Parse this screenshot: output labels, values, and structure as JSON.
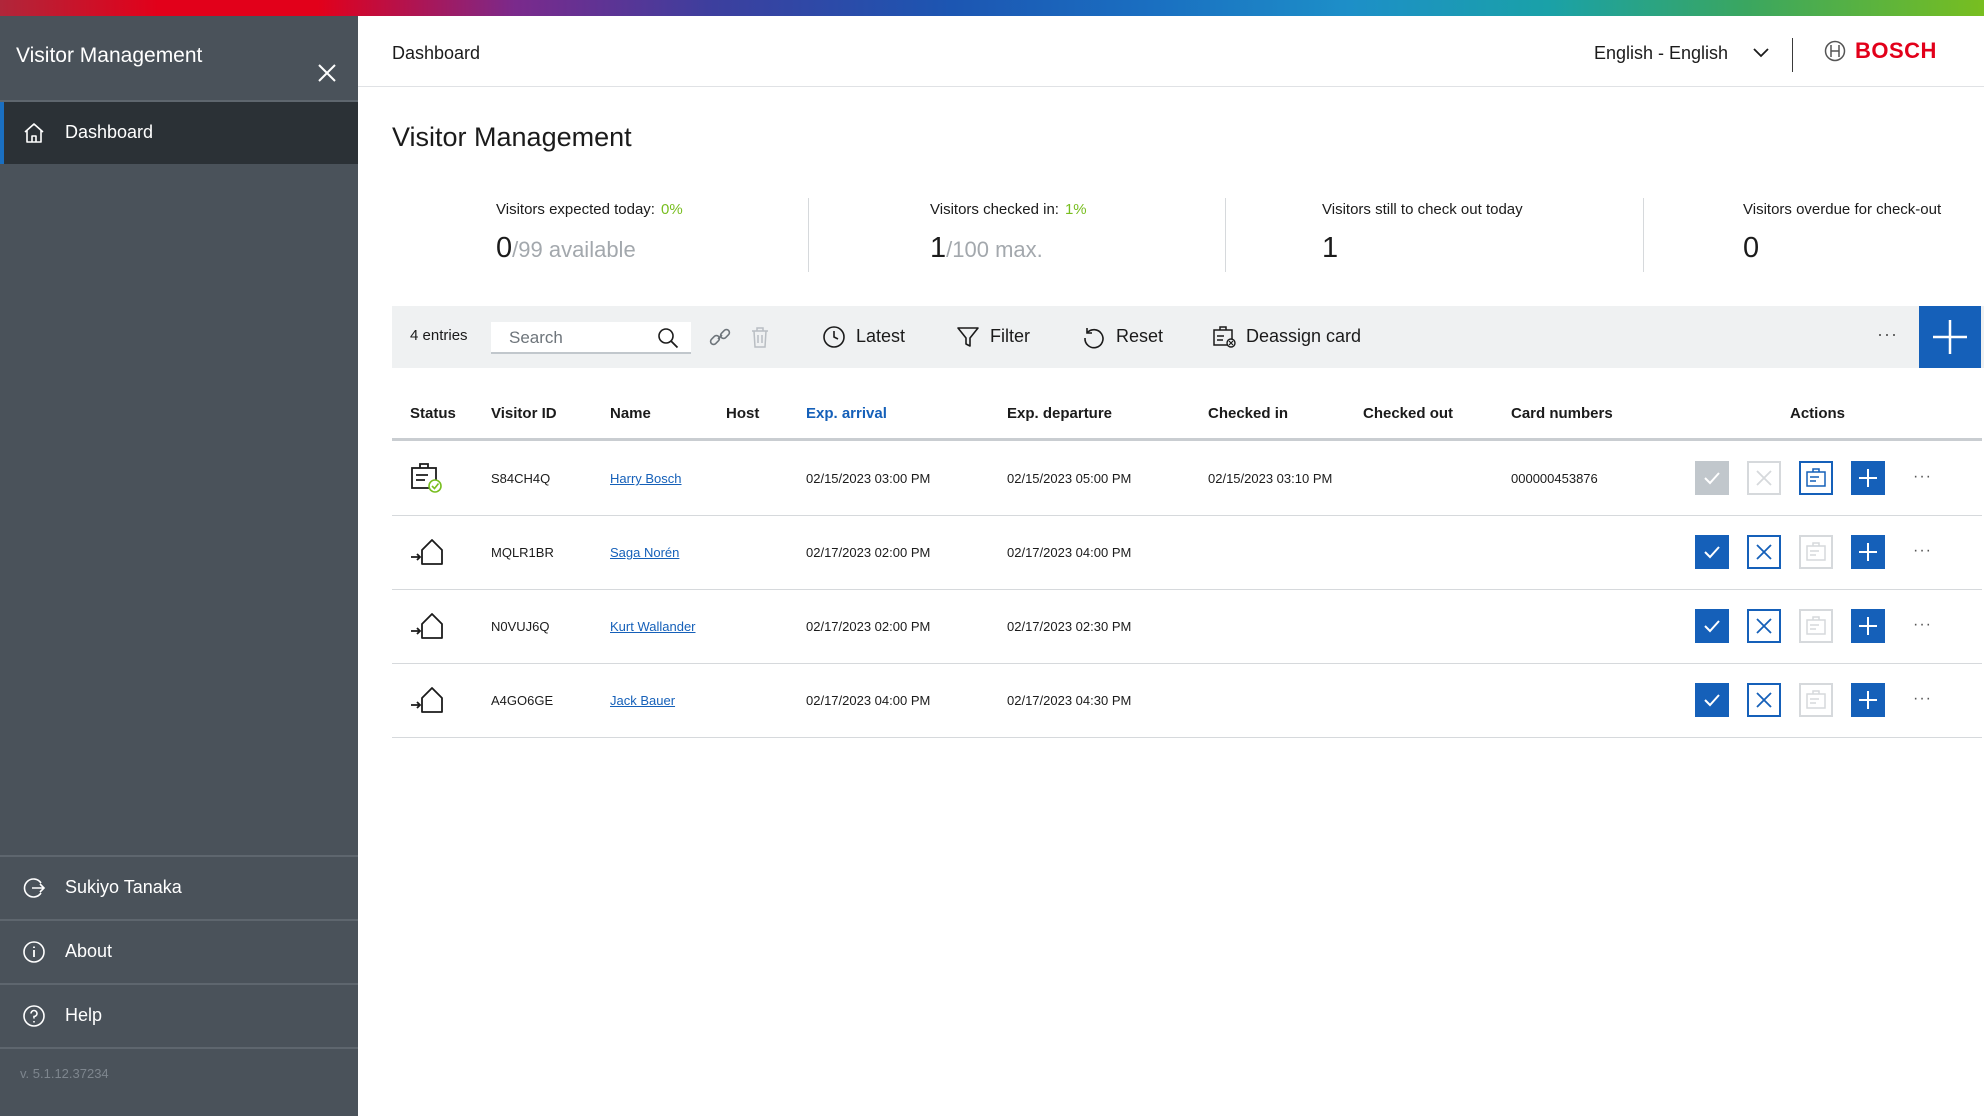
{
  "sidebar": {
    "title": "Visitor Management",
    "nav": [
      {
        "label": "Dashboard",
        "icon": "home-icon"
      }
    ],
    "footer": [
      {
        "label": "Sukiyo Tanaka",
        "icon": "logout-icon"
      },
      {
        "label": "About",
        "icon": "info-icon"
      },
      {
        "label": "Help",
        "icon": "help-icon"
      }
    ],
    "version": "v. 5.1.12.37234"
  },
  "header": {
    "breadcrumb": "Dashboard",
    "language": "English - English",
    "brand": "BOSCH"
  },
  "page": {
    "title": "Visitor Management"
  },
  "stats": [
    {
      "label": "Visitors expected today:",
      "pct": "0%",
      "value": "0",
      "sub": "/99 available"
    },
    {
      "label": "Visitors checked in:",
      "pct": "1%",
      "value": "1",
      "sub": "/100 max."
    },
    {
      "label": "Visitors still to check out today",
      "pct": "",
      "value": "1",
      "sub": ""
    },
    {
      "label": "Visitors overdue for check-out",
      "pct": "",
      "value": "0",
      "sub": ""
    }
  ],
  "toolbar": {
    "entries": "4 entries",
    "search_placeholder": "Search",
    "latest": "Latest",
    "filter": "Filter",
    "reset": "Reset",
    "deassign": "Deassign card",
    "more": "···"
  },
  "table": {
    "columns": [
      "Status",
      "Visitor ID",
      "Name",
      "Host",
      "Exp. arrival",
      "Exp. departure",
      "Checked in",
      "Checked out",
      "Card numbers",
      "Actions"
    ],
    "rows": [
      {
        "status": "checked-in",
        "visitor_id": "S84CH4Q",
        "name": "Harry Bosch",
        "host": "",
        "exp_arrival": "02/15/2023 03:00 PM",
        "exp_departure": "02/15/2023 05:00 PM",
        "checked_in": "02/15/2023 03:10 PM",
        "checked_out": "",
        "card_numbers": "000000453876",
        "more": "···"
      },
      {
        "status": "expected",
        "visitor_id": "MQLR1BR",
        "name": "Saga Norén",
        "host": "",
        "exp_arrival": "02/17/2023 02:00 PM",
        "exp_departure": "02/17/2023 04:00 PM",
        "checked_in": "",
        "checked_out": "",
        "card_numbers": "",
        "more": "···"
      },
      {
        "status": "expected",
        "visitor_id": "N0VUJ6Q",
        "name": "Kurt Wallander",
        "host": "",
        "exp_arrival": "02/17/2023 02:00 PM",
        "exp_departure": "02/17/2023 02:30 PM",
        "checked_in": "",
        "checked_out": "",
        "card_numbers": "",
        "more": "···"
      },
      {
        "status": "expected",
        "visitor_id": "A4GO6GE",
        "name": "Jack Bauer",
        "host": "",
        "exp_arrival": "02/17/2023 04:00 PM",
        "exp_departure": "02/17/2023 04:30 PM",
        "checked_in": "",
        "checked_out": "",
        "card_numbers": "",
        "more": "···"
      }
    ]
  },
  "colors": {
    "accent": "#1560b9",
    "brand_red": "#e2001a",
    "positive": "#78be20",
    "sidebar": "#4a525a"
  }
}
